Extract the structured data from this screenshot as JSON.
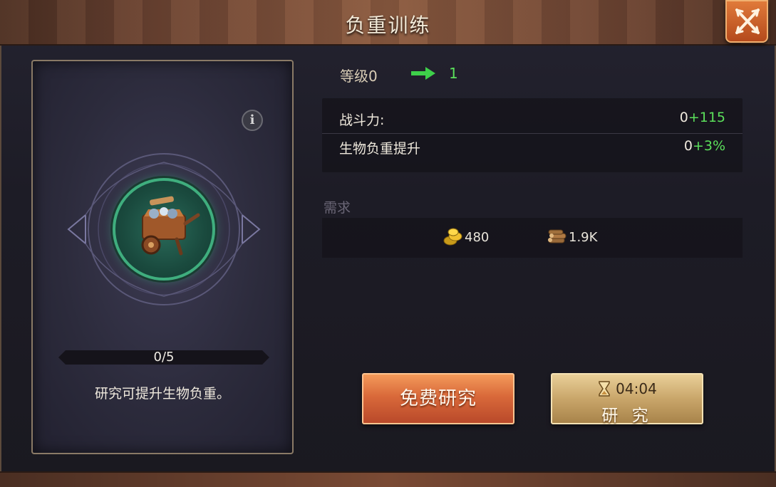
{
  "window": {
    "title": "负重训练"
  },
  "card": {
    "progress_text": "0/5",
    "progress_fraction": 0,
    "description": "研究可提升生物负重。"
  },
  "level": {
    "label": "等级0",
    "next": "1"
  },
  "stats": [
    {
      "name": "战斗力:",
      "base": "0",
      "bonus": "+115"
    },
    {
      "name": "生物负重提升",
      "base": "0",
      "bonus": "+3%"
    }
  ],
  "requirements": {
    "label": "需求",
    "items": [
      {
        "icon": "gold-coins-icon",
        "value": "480"
      },
      {
        "icon": "wood-logs-icon",
        "value": "1.9K"
      }
    ]
  },
  "buttons": {
    "free_research": "免费研究",
    "research_time": "04:04",
    "research": "研 究"
  },
  "colors": {
    "bonus_green": "#5be05b",
    "free_button": "#d9693a",
    "research_button": "#c9a66a",
    "ring_green": "#3fae7e"
  }
}
